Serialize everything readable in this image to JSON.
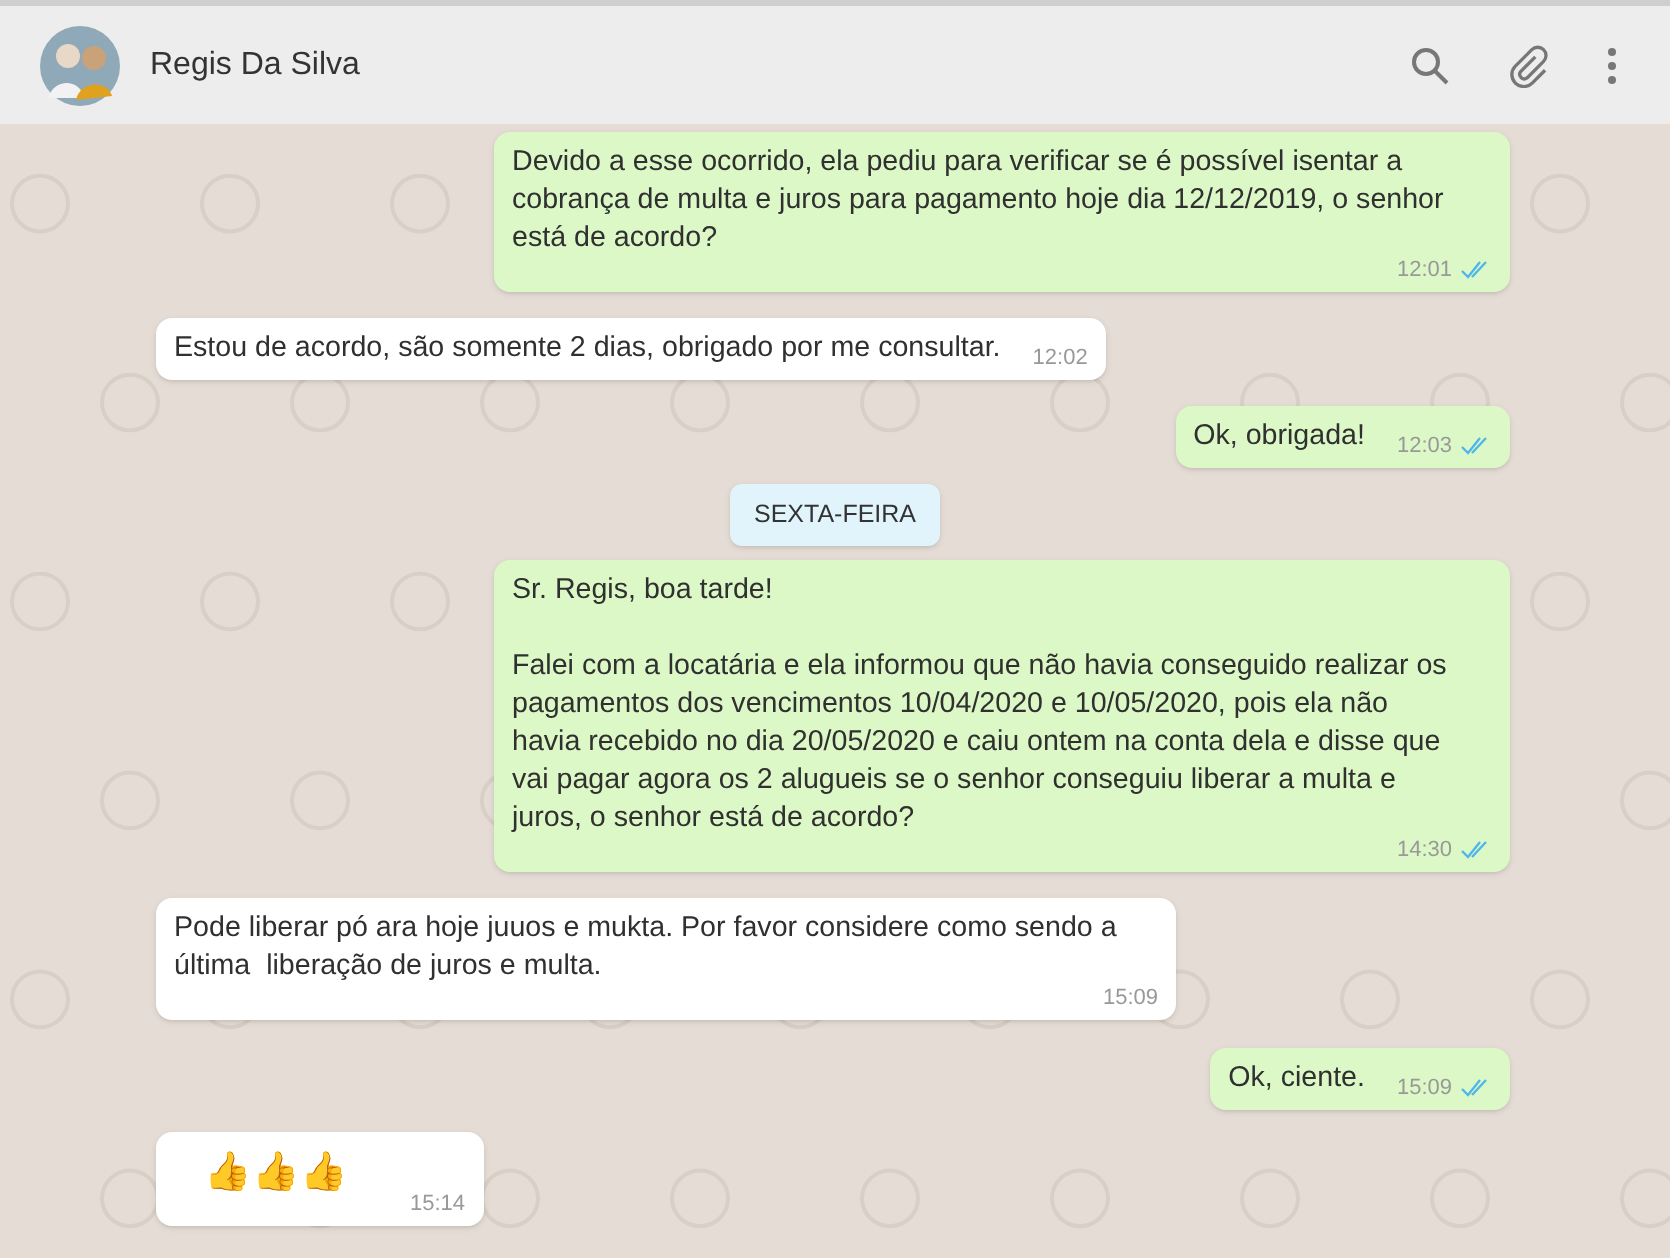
{
  "header": {
    "contact_name": "Regis Da Silva"
  },
  "messages": [
    {
      "kind": "out",
      "text": "Devido a esse ocorrido, ela pediu para verificar se é possível isentar a cobrança de multa e juros para pagamento hoje dia 12/12/2019, o senhor está de acordo?",
      "time": "12:01",
      "read": true
    },
    {
      "kind": "in",
      "text": "Estou de acordo, são somente 2 dias, obrigado por me consultar.",
      "time": "12:02"
    },
    {
      "kind": "out",
      "text": "Ok, obrigada!",
      "time": "12:03",
      "read": true
    },
    {
      "kind": "date",
      "text": "SEXTA-FEIRA"
    },
    {
      "kind": "out",
      "text": "Sr. Regis, boa tarde!\n\nFalei com a locatária e ela informou que não havia conseguido realizar os pagamentos dos vencimentos 10/04/2020 e 10/05/2020, pois ela não havia recebido no dia 20/05/2020 e caiu ontem na conta dela e disse que vai pagar agora os 2 alugueis se o senhor conseguiu liberar a multa e juros, o senhor está de acordo?",
      "time": "14:30",
      "read": true
    },
    {
      "kind": "in",
      "text": "Pode liberar pó ara hoje juuos e mukta. Por favor considere como sendo a última  liberação de juros e multa.",
      "time": "15:09"
    },
    {
      "kind": "out",
      "text": "Ok, ciente.",
      "time": "15:09",
      "read": true
    },
    {
      "kind": "emoji",
      "text": "👍👍👍",
      "time": "15:14"
    }
  ]
}
